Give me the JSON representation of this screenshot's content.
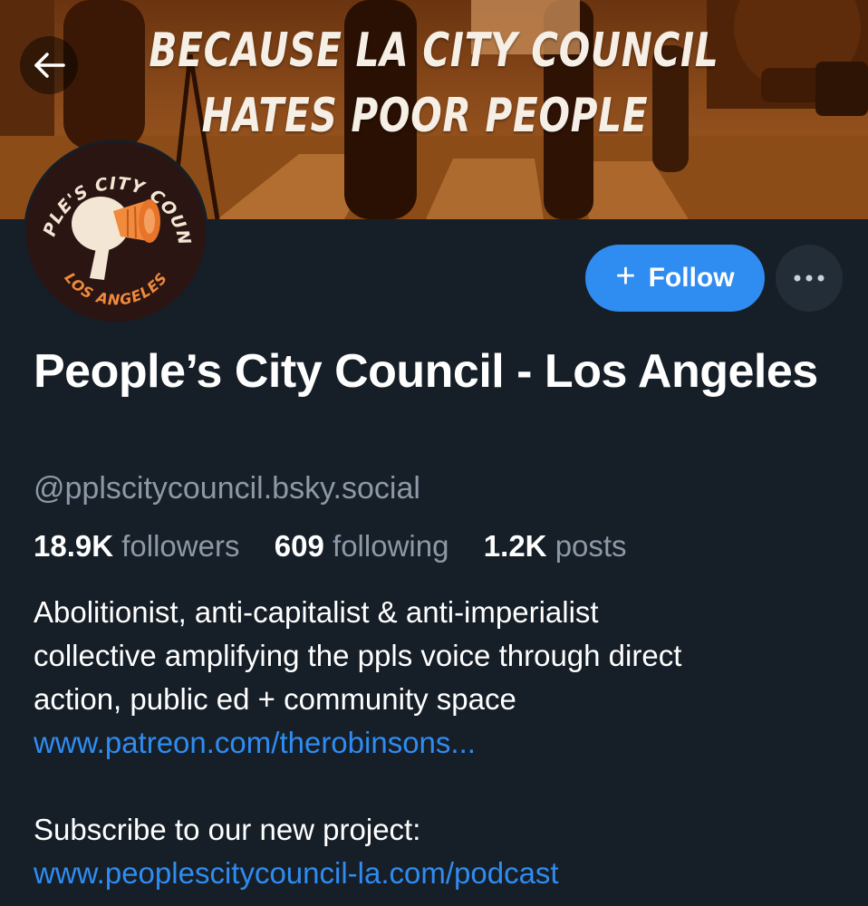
{
  "banner": {
    "line1": "BECAUSE LA CITY COUNCIL",
    "line2": "HATES POOR PEOPLE"
  },
  "avatar": {
    "arc_top": "PEOPLE'S CITY COUNCIL",
    "arc_bottom": "LOS ANGELES"
  },
  "actions": {
    "follow_plus": "+",
    "follow_label": "Follow",
    "more_label": "•••"
  },
  "profile": {
    "display_name": "People’s City Council - Los Angeles",
    "handle": "@pplscitycouncil.bsky.social",
    "stats": {
      "followers_count": "18.9K",
      "followers_label": "followers",
      "following_count": "609",
      "following_label": "following",
      "posts_count": "1.2K",
      "posts_label": "posts"
    },
    "bio": {
      "line1": "Abolitionist, anti-capitalist & anti-imperialist",
      "line2": "collective amplifying the ppls voice through direct",
      "line3": "action, public ed + community space",
      "link1": "www.patreon.com/therobinsons...",
      "line4": "Subscribe to our new project:",
      "link2": "www.peoplescitycouncil-la.com/podcast"
    }
  },
  "colors": {
    "background": "#161e27",
    "accent": "#2f8cf0",
    "muted_text": "#8d99a7",
    "banner_orange": "#a65e24"
  },
  "icons": {
    "back": "arrow-left-icon",
    "more": "ellipsis-icon"
  }
}
